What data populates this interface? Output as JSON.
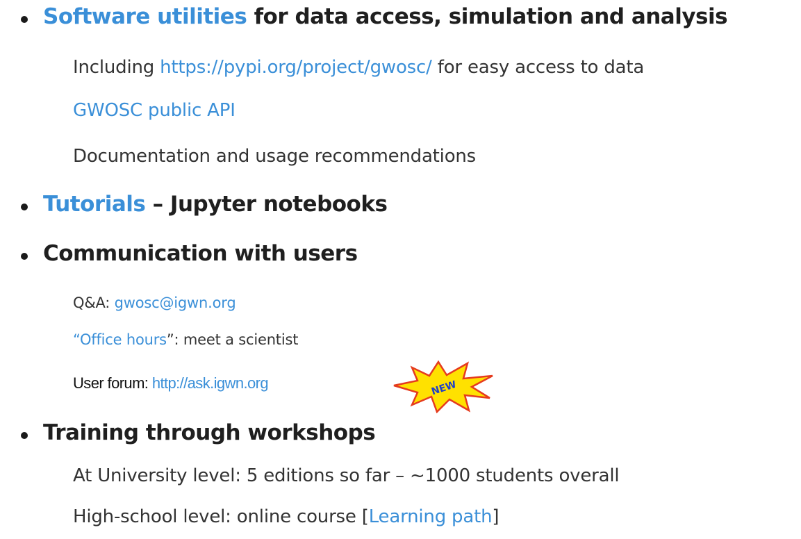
{
  "bullets": {
    "software": {
      "link": "Software utilities",
      "rest": " for data access, simulation and analysis",
      "subs": {
        "including_pre": "Including ",
        "including_link": "https://pypi.org/project/gwosc/",
        "including_post": " for easy access to data",
        "api_link": "GWOSC public API",
        "docs": "Documentation and usage recommendations"
      }
    },
    "tutorials": {
      "link": "Tutorials",
      "rest": " – Jupyter notebooks"
    },
    "communication": {
      "text": "Communication with users",
      "subs": {
        "qa_pre": "Q&A: ",
        "qa_link": "gwosc@igwn.org",
        "office_open": "“",
        "office_link": "Office hours",
        "office_post": "”: meet a scientist",
        "forum_pre": "User forum: ",
        "forum_link": "http://ask.igwn.org",
        "new_badge": "NEW"
      }
    },
    "training": {
      "text": "Training through workshops",
      "subs": {
        "university": "At University level: 5 editions so far – ~1000 students overall",
        "highschool_pre": "High-school level: online course [",
        "highschool_link": "Learning path",
        "highschool_post": "]"
      }
    }
  },
  "colors": {
    "link": "#3a8fd8",
    "text": "#1f1f1f",
    "badge_fill": "#ffe100",
    "badge_stroke": "#e53b1e",
    "badge_text": "#1e3fc9"
  }
}
